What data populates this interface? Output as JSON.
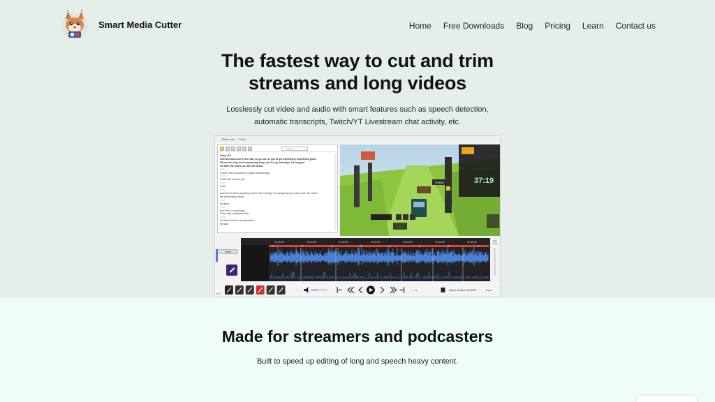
{
  "header": {
    "brand": "Smart Media Cutter",
    "logo_icon": "lynx-mascot-icon",
    "nav": [
      {
        "label": "Home"
      },
      {
        "label": "Free Downloads"
      },
      {
        "label": "Blog"
      },
      {
        "label": "Pricing"
      },
      {
        "label": "Learn"
      },
      {
        "label": "Contact us"
      }
    ]
  },
  "hero": {
    "title_line1": "The fastest way to cut and trim",
    "title_line2": "streams and long videos",
    "subtitle_line1": "Losslessly cut video and audio with smart features such as speech detection,",
    "subtitle_line2": "automatic transcripts, Twitch/YT Livestream chat activity, etc."
  },
  "app_preview": {
    "menu": [
      "Basic cuts",
      "Tools"
    ],
    "search_placeholder": "Search",
    "transcript_lines": [
      {
        "text": "Okay #10",
        "style": "b"
      },
      {
        "text": "Still two takes out of the way so go out we got to get something something good",
        "style": "b"
      },
      {
        "text": "Where the map isn't respawning okay, uh let's go brooklyn. Oh my god.",
        "style": "b"
      },
      {
        "text": "Ok With the snow car with the brake",
        "style": "b"
      },
      {
        "text": "0:31",
        "style": "g"
      },
      {
        "text": "I mean, this is gonna be a quite unusual way.",
        "style": ""
      },
      {
        "text": "0:43",
        "style": "g"
      },
      {
        "text": "That's all I can tell you",
        "style": ""
      },
      {
        "text": "0:50",
        "style": "g"
      },
      {
        "text": "Yeah",
        "style": ""
      },
      {
        "text": "0:56",
        "style": "g"
      },
      {
        "text": "And then is there anything weird in the ending? I'm not gonna try to show this. Oh, that's",
        "style": ""
      },
      {
        "text": "the same thing. Okay.",
        "style": ""
      },
      {
        "text": "1:12",
        "style": "g"
      },
      {
        "text": "All good",
        "style": ""
      },
      {
        "text": "1:19",
        "style": "g"
      },
      {
        "text": "And this is a cute map.",
        "style": ""
      },
      {
        "text": "Cute map, completely fine.",
        "style": ""
      },
      {
        "text": "1:24",
        "style": "g"
      },
      {
        "text": "Oh that so that is a bad pattern",
        "style": ""
      },
      {
        "text": "No way",
        "style": ""
      }
    ],
    "video": {
      "hud_time": "37:19",
      "banner": "TURBO"
    },
    "timeline_ticks": [
      "00:00:00",
      "00:20:00",
      "00:40:00",
      "01:00:00",
      "01:20:00",
      "01:40:00",
      "02:00:00"
    ],
    "speed": "1.0x",
    "export_duration": "Export duration: 28:26:20",
    "export_label": "Export",
    "mode_label": "Mode",
    "version": "v0.7",
    "max_level_label": "Max",
    "level_label": "Level"
  },
  "section2": {
    "title": "Made for streamers and podcasters",
    "subtitle": "Built to speed up editing of long and speech heavy content."
  },
  "colors": {
    "hero_bg": "#e6eeea",
    "lower_bg": "#effdf8",
    "timeline_bg": "#232323",
    "waveform": "#4a7fd6",
    "cut_marker": "#e0402d",
    "grass": "#9bd04a"
  }
}
